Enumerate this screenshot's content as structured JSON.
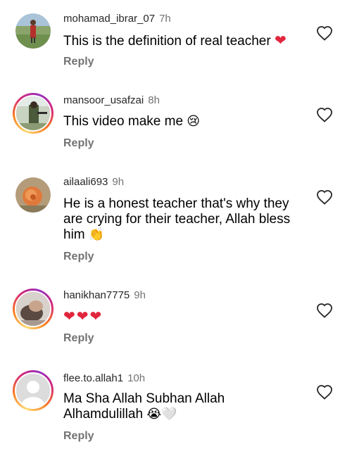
{
  "comments": [
    {
      "username": "mohamad_ibrar_07",
      "time": "7h",
      "text": "This is the definition of real teacher",
      "emoji": "❤",
      "reply": "Reply"
    },
    {
      "username": "mansoor_usafzai",
      "time": "8h",
      "text": "This video make me",
      "emoji": "😢",
      "reply": "Reply"
    },
    {
      "username": "ailaali693",
      "time": "9h",
      "text": "He is a honest teacher that's why they are crying for their teacher, Allah bless him",
      "emoji": "👏",
      "reply": "Reply"
    },
    {
      "username": "hanikhan7775",
      "time": "9h",
      "text": "",
      "emoji": "❤❤❤",
      "reply": "Reply"
    },
    {
      "username": "flee.to.allah1",
      "time": "10h",
      "text": "Ma Sha Allah Subhan Allah Alhamdulillah",
      "emoji": "😭🤍",
      "reply": "Reply"
    }
  ],
  "icons": {
    "like": "heart-outline-icon"
  },
  "colors": {
    "heart_emoji": "#e0263c",
    "meta_gray": "#737373",
    "story_ring": "#d62976"
  }
}
